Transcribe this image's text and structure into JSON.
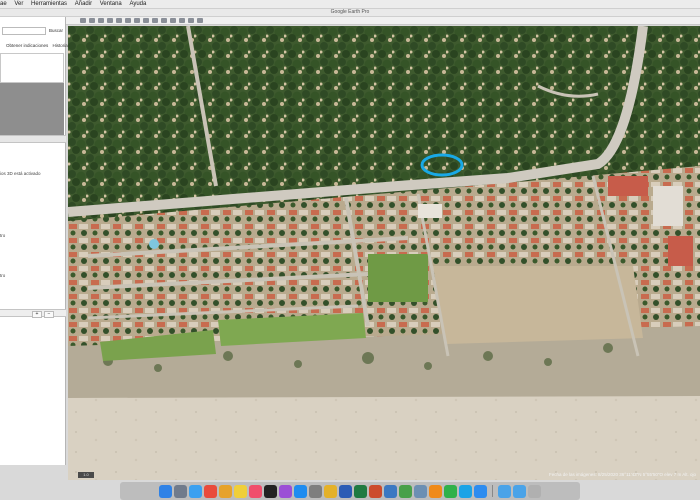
{
  "menubar": {
    "items": [
      "ae",
      "Ver",
      "Herramientas",
      "Añadir",
      "Ventana",
      "Ayuda"
    ]
  },
  "window": {
    "title": "Google Earth Pro"
  },
  "sidebar": {
    "search_button": "Buscar",
    "links": [
      "Obtener indicaciones",
      "Historial"
    ],
    "layers": [
      {
        "text": "ios 3D está activado"
      },
      {
        "text": "tro"
      },
      {
        "text": "tro"
      }
    ],
    "footer_buttons": [
      "+",
      "−"
    ]
  },
  "map": {
    "status": "Fecha de las imágenes: 8/25/2020   36°11'43\"N   5°55'50\"O   elev 7 m   Alt. ojo",
    "corner_label": "1.0"
  },
  "dock": {
    "apps": [
      {
        "icon": "finder-icon",
        "color": "#2f82e6"
      },
      {
        "icon": "launchpad-icon",
        "color": "#707b8c"
      },
      {
        "icon": "safari-icon",
        "color": "#3aa0f0"
      },
      {
        "icon": "calendar-icon",
        "color": "#e94b3c"
      },
      {
        "icon": "photos-icon",
        "color": "#e6a22b"
      },
      {
        "icon": "notes-icon",
        "color": "#f0cf3a"
      },
      {
        "icon": "music-icon",
        "color": "#f04e6c"
      },
      {
        "icon": "tv-icon",
        "color": "#222222"
      },
      {
        "icon": "podcasts-icon",
        "color": "#9b4fd6"
      },
      {
        "icon": "appstore-icon",
        "color": "#1e8cf0"
      },
      {
        "icon": "settings-icon",
        "color": "#7e7e7e"
      },
      {
        "icon": "chrome-icon",
        "color": "#e4b12a"
      },
      {
        "icon": "word-icon",
        "color": "#2b5cb5"
      },
      {
        "icon": "excel-icon",
        "color": "#1f7a42"
      },
      {
        "icon": "powerpoint-icon",
        "color": "#cc4b2c"
      },
      {
        "icon": "googleearth-icon",
        "color": "#3b78c2"
      },
      {
        "icon": "maps-icon",
        "color": "#48a04a"
      },
      {
        "icon": "preview-icon",
        "color": "#6c8fb3"
      },
      {
        "icon": "vlc-icon",
        "color": "#ef8a1a"
      },
      {
        "icon": "whatsapp-icon",
        "color": "#30b14a"
      },
      {
        "icon": "skype-icon",
        "color": "#1aa3e6"
      },
      {
        "icon": "zoom-icon",
        "color": "#2d8cf0"
      }
    ],
    "trailing": [
      {
        "icon": "folder-icon",
        "color": "#4aa3e8"
      },
      {
        "icon": "downloads-icon",
        "color": "#4aa3e8"
      },
      {
        "icon": "trash-icon",
        "color": "#b0b0b0"
      }
    ]
  }
}
